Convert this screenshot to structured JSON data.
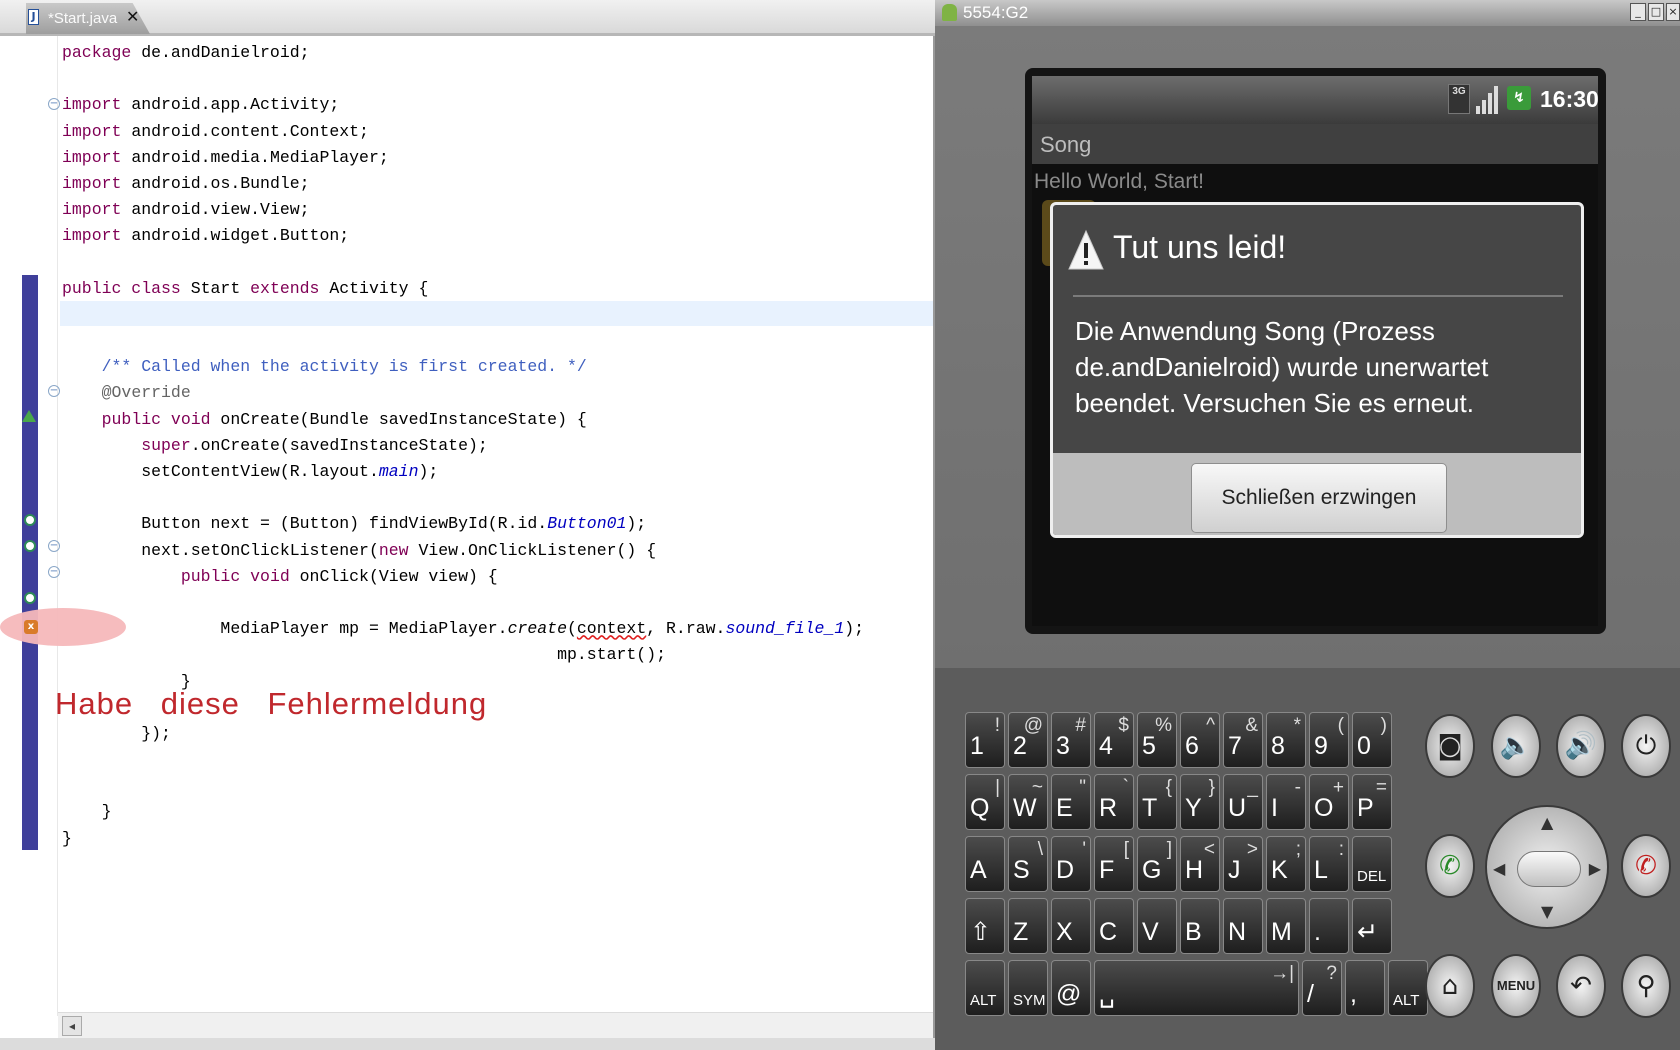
{
  "editor": {
    "tab": {
      "label": "*Start.java",
      "close": "✕"
    },
    "code_lines": [
      {
        "t": [
          {
            "c": "kw",
            "s": "package"
          },
          {
            "s": " de.andDanielroid;"
          }
        ]
      },
      {
        "t": []
      },
      {
        "t": [
          {
            "c": "kw",
            "s": "import"
          },
          {
            "s": " android.app.Activity;"
          }
        ]
      },
      {
        "t": [
          {
            "c": "kw",
            "s": "import"
          },
          {
            "s": " android.content.Context;"
          }
        ]
      },
      {
        "t": [
          {
            "c": "kw",
            "s": "import"
          },
          {
            "s": " android.media.MediaPlayer;"
          }
        ]
      },
      {
        "t": [
          {
            "c": "kw",
            "s": "import"
          },
          {
            "s": " android.os.Bundle;"
          }
        ]
      },
      {
        "t": [
          {
            "c": "kw",
            "s": "import"
          },
          {
            "s": " android.view.View;"
          }
        ]
      },
      {
        "t": [
          {
            "c": "kw",
            "s": "import"
          },
          {
            "s": " android.widget.Button;"
          }
        ]
      },
      {
        "t": []
      },
      {
        "t": [
          {
            "c": "kw",
            "s": "public class"
          },
          {
            "s": " Start "
          },
          {
            "c": "kw",
            "s": "extends"
          },
          {
            "s": " Activity {"
          }
        ]
      },
      {
        "t": []
      },
      {
        "t": []
      },
      {
        "t": [
          {
            "s": "    "
          },
          {
            "c": "cm",
            "s": "/** Called when the activity is first created. */"
          }
        ]
      },
      {
        "t": [
          {
            "s": "    "
          },
          {
            "c": "an",
            "s": "@Override"
          }
        ]
      },
      {
        "t": [
          {
            "s": "    "
          },
          {
            "c": "kw",
            "s": "public void"
          },
          {
            "s": " onCreate(Bundle savedInstanceState) {"
          }
        ]
      },
      {
        "t": [
          {
            "s": "        "
          },
          {
            "c": "kw",
            "s": "super"
          },
          {
            "s": ".onCreate(savedInstanceState);"
          }
        ]
      },
      {
        "t": [
          {
            "s": "        setContentView(R.layout."
          },
          {
            "c": "fi",
            "s": "main"
          },
          {
            "s": ");"
          }
        ]
      },
      {
        "t": []
      },
      {
        "t": [
          {
            "s": "        Button next = (Button) findViewById(R.id."
          },
          {
            "c": "fi",
            "s": "Button01"
          },
          {
            "s": ");"
          }
        ]
      },
      {
        "t": [
          {
            "s": "        next.setOnClickListener("
          },
          {
            "c": "kw",
            "s": "new"
          },
          {
            "s": " View.OnClickListener() {"
          }
        ]
      },
      {
        "t": [
          {
            "s": "            "
          },
          {
            "c": "kw",
            "s": "public void"
          },
          {
            "s": " onClick(View view) {"
          }
        ]
      },
      {
        "t": []
      },
      {
        "t": [
          {
            "s": "                MediaPlayer mp = MediaPlayer."
          },
          {
            "c": "it",
            "s": "create"
          },
          {
            "s": "("
          },
          {
            "c": "sq",
            "s": "context"
          },
          {
            "s": ", R.raw."
          },
          {
            "c": "fi",
            "s": "sound_file_1"
          },
          {
            "s": ");"
          }
        ]
      },
      {
        "t": [
          {
            "s": "                                                  mp.start();"
          }
        ]
      },
      {
        "t": [
          {
            "s": "            }"
          }
        ]
      },
      {
        "t": []
      },
      {
        "t": [
          {
            "s": "        });"
          }
        ]
      },
      {
        "t": []
      },
      {
        "t": []
      },
      {
        "t": [
          {
            "s": "    }"
          }
        ]
      },
      {
        "t": [
          {
            "s": "}"
          }
        ]
      }
    ],
    "annotation_note": "Habe diese Fehlermeldung"
  },
  "emulator": {
    "window_title": "5554:G2",
    "status_bar": {
      "network": "3G",
      "time": "16:30"
    },
    "app_title": "Song",
    "hello_text": "Hello World, Start!",
    "dialog": {
      "title": "Tut uns leid!",
      "message": "Die Anwendung Song (Prozess de.andDanielroid) wurde unerwartet beendet. Versuchen Sie es erneut.",
      "button": "Schließen erzwingen"
    },
    "keyboard_rows": [
      [
        {
          "m": "1",
          "a": "!"
        },
        {
          "m": "2",
          "a": "@"
        },
        {
          "m": "3",
          "a": "#"
        },
        {
          "m": "4",
          "a": "$"
        },
        {
          "m": "5",
          "a": "%"
        },
        {
          "m": "6",
          "a": "^"
        },
        {
          "m": "7",
          "a": "&"
        },
        {
          "m": "8",
          "a": "*"
        },
        {
          "m": "9",
          "a": "("
        },
        {
          "m": "0",
          "a": ")"
        }
      ],
      [
        {
          "m": "Q",
          "a": "|"
        },
        {
          "m": "W",
          "a": "~"
        },
        {
          "m": "E",
          "a": "\""
        },
        {
          "m": "R",
          "a": "`"
        },
        {
          "m": "T",
          "a": "{"
        },
        {
          "m": "Y",
          "a": "}"
        },
        {
          "m": "U",
          "a": "_"
        },
        {
          "m": "I",
          "a": "-"
        },
        {
          "m": "O",
          "a": "+"
        },
        {
          "m": "P",
          "a": "="
        }
      ],
      [
        {
          "m": "A",
          "a": ""
        },
        {
          "m": "S",
          "a": "\\"
        },
        {
          "m": "D",
          "a": "'"
        },
        {
          "m": "F",
          "a": "["
        },
        {
          "m": "G",
          "a": "]"
        },
        {
          "m": "H",
          "a": "<"
        },
        {
          "m": "J",
          "a": ">"
        },
        {
          "m": "K",
          "a": ";"
        },
        {
          "m": "L",
          "a": ":"
        },
        {
          "m": "DEL",
          "a": ""
        }
      ],
      [
        {
          "m": "⇧",
          "a": ""
        },
        {
          "m": "Z",
          "a": ""
        },
        {
          "m": "X",
          "a": ""
        },
        {
          "m": "C",
          "a": ""
        },
        {
          "m": "V",
          "a": ""
        },
        {
          "m": "B",
          "a": ""
        },
        {
          "m": "N",
          "a": ""
        },
        {
          "m": "M",
          "a": ""
        },
        {
          "m": ".",
          "a": ""
        },
        {
          "m": "↵",
          "a": ""
        }
      ],
      [
        {
          "m": "ALT",
          "a": ""
        },
        {
          "m": "SYM",
          "a": ""
        },
        {
          "m": "@",
          "a": ""
        },
        {
          "m": "␣",
          "a": "→|"
        },
        {
          "m": "/",
          "a": "?"
        },
        {
          "m": ",",
          "a": ""
        },
        {
          "m": "ALT",
          "a": ""
        }
      ]
    ],
    "controls": {
      "menu_label": "MENU"
    }
  }
}
